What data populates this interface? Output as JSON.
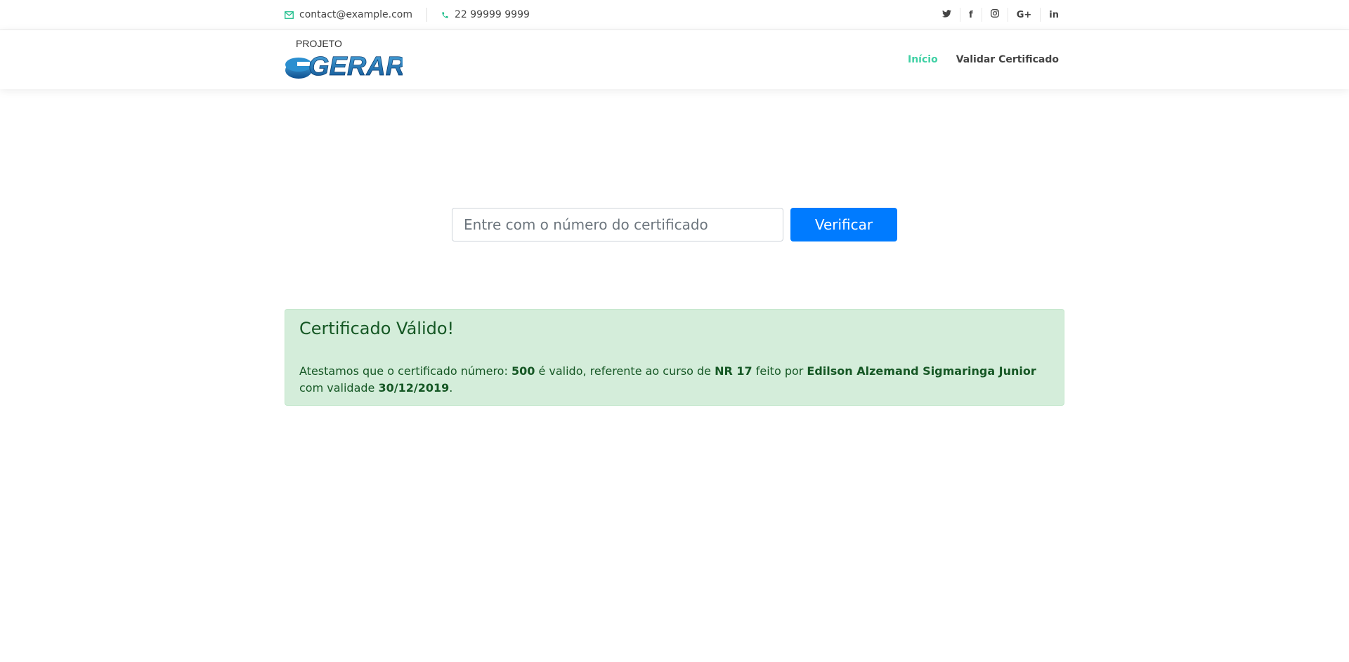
{
  "topbar": {
    "email": "contact@example.com",
    "phone": "22 99999 9999",
    "social": [
      {
        "icon": "twitter-icon",
        "label": ""
      },
      {
        "icon": "facebook-icon",
        "label": "f"
      },
      {
        "icon": "instagram-icon",
        "label": ""
      },
      {
        "icon": "google-plus-icon",
        "label": "G+"
      },
      {
        "icon": "linkedin-icon",
        "label": "in"
      }
    ]
  },
  "header": {
    "logo_top": "PROJETO",
    "logo_main": "GERAR",
    "nav": [
      {
        "label": "Início",
        "active": true
      },
      {
        "label": "Validar Certificado",
        "active": false
      }
    ]
  },
  "search": {
    "placeholder": "Entre com o número do certificado",
    "value": "",
    "button_label": "Verificar"
  },
  "result": {
    "heading": "Certificado Válido!",
    "text_1": "Atestamos que o certificado número: ",
    "number": "500",
    "text_2": " é valido, referente ao curso de ",
    "course": "NR 17",
    "text_3": " feito por ",
    "person": "Edilson Alzemand Sigmaringa Junior",
    "text_4": " com validade ",
    "validity": "30/12/2019",
    "text_5": "."
  },
  "colors": {
    "accent": "#3fd0a4",
    "primary_button": "#007bff",
    "success_bg": "#d4edda",
    "success_text": "#155724",
    "logo_blue": "#1a6fb5"
  }
}
